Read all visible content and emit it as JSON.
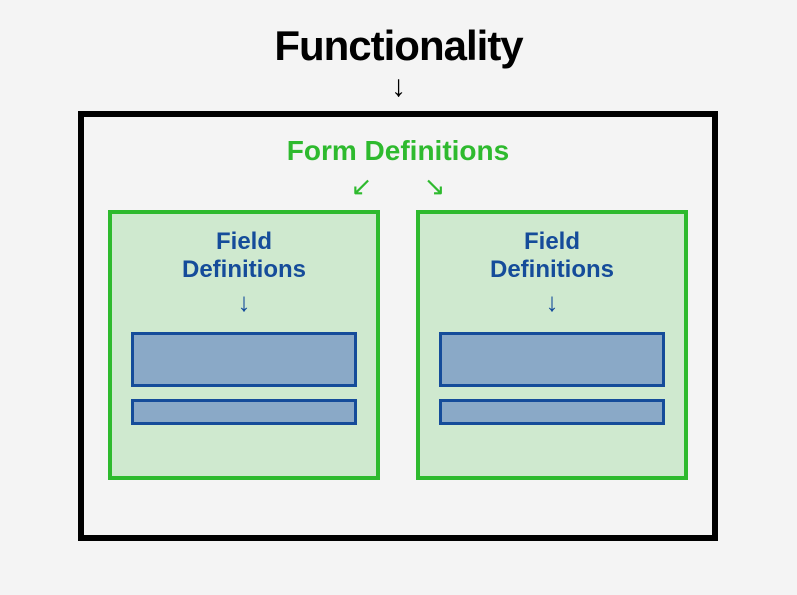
{
  "colors": {
    "background": "#f4f4f4",
    "outer_border": "#000000",
    "form_green": "#2eba2e",
    "field_bg": "#cfe9cf",
    "field_blue": "#154c9a",
    "slot_fill": "#8aa9c7"
  },
  "title": "Functionality",
  "title_arrow": "↓",
  "form": {
    "title": "Form Definitions",
    "arrow_left": "↙",
    "arrow_right": "↘",
    "fields": [
      {
        "title_line1": "Field",
        "title_line2": "Definitions",
        "arrow": "↓"
      },
      {
        "title_line1": "Field",
        "title_line2": "Definitions",
        "arrow": "↓"
      }
    ]
  }
}
